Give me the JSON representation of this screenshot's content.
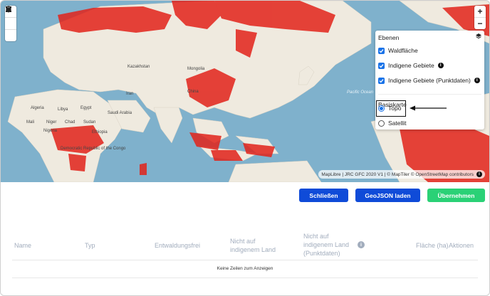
{
  "map": {
    "labels": {
      "kazakhstan": "Kazakhstan",
      "mongolia": "Mongolia",
      "iran": "Iran",
      "china": "China",
      "algeria": "Algeria",
      "libya": "Libya",
      "egypt": "Egypt",
      "mali": "Mali",
      "niger": "Niger",
      "chad": "Chad",
      "sudan": "Sudan",
      "nigeria": "Nigeria",
      "ethiopia": "Ethiopia",
      "saudi": "Saudi Arabia",
      "drc": "Democratic Republic of the Congo",
      "pacific": "Pacific Ocean"
    },
    "attribution": "MapLibre | JRC GFC 2020 V1 | © MapTiler © OpenStreetMap contributors",
    "zoom_in": "+",
    "zoom_out": "−",
    "colors": {
      "water": "#7fb1cc",
      "land": "#efeadf",
      "forest": "#e2231a"
    }
  },
  "layers": {
    "title": "Ebenen",
    "items": [
      {
        "label": "Waldfläche",
        "checked": true,
        "info": false
      },
      {
        "label": "Indigene Gebiete",
        "checked": true,
        "info": true
      },
      {
        "label": "Indigene Gebiete (Punktdaten)",
        "checked": true,
        "info": true
      }
    ],
    "basemap_title": "Basiskarte",
    "basemaps": [
      {
        "label": "Topo",
        "selected": true
      },
      {
        "label": "Satellit",
        "selected": false
      }
    ]
  },
  "buttons": {
    "close": "Schließen",
    "geojson": "GeoJSON laden",
    "apply": "Übernehmen"
  },
  "table": {
    "headers": {
      "name": "Name",
      "typ": "Typ",
      "entwaldung": "Entwaldungsfrei",
      "nicht_land_1": "Nicht auf",
      "nicht_land_2": "indigenem Land",
      "nicht_punkt_1": "Nicht auf",
      "nicht_punkt_2": "indigenem Land",
      "nicht_punkt_3": "(Punktdaten)",
      "flaeche": "Fläche (ha)",
      "aktionen": "Aktionen"
    },
    "empty_text": "Keine Zeilen zum Anzeigen"
  }
}
